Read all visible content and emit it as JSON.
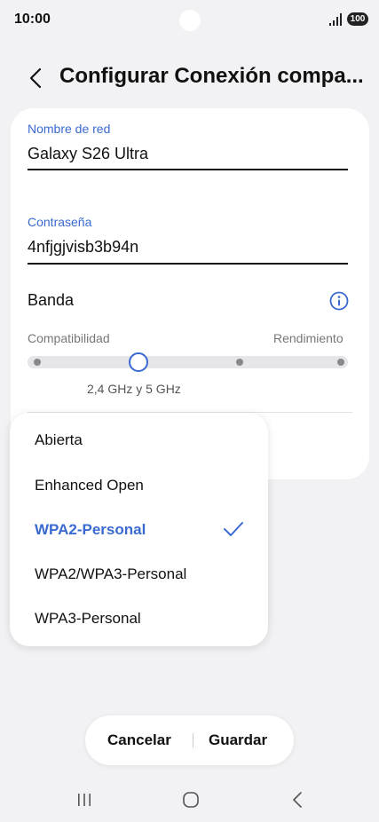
{
  "status_bar": {
    "time": "10:00",
    "battery": "100"
  },
  "header": {
    "title": "Configurar Conexión compa..."
  },
  "network_name": {
    "label": "Nombre de red",
    "value": "Galaxy S26 Ultra"
  },
  "password": {
    "label": "Contraseña",
    "value": "4nfjgjvisb3b94n"
  },
  "band": {
    "label": "Banda",
    "left_label": "Compatibilidad",
    "right_label": "Rendimiento",
    "selected_value": "2,4 GHz y 5 GHz",
    "positions": 4,
    "selected_index": 1
  },
  "security_menu": {
    "items": [
      "Abierta",
      "Enhanced Open",
      "WPA2-Personal",
      "WPA2/WPA3-Personal",
      "WPA3-Personal"
    ],
    "selected": "WPA2-Personal"
  },
  "actions": {
    "cancel": "Cancelar",
    "save": "Guardar"
  },
  "colors": {
    "accent": "#3a6ad0",
    "background": "#f2f2f4",
    "card": "#ffffff"
  },
  "icons": [
    "back-icon",
    "info-icon",
    "check-icon",
    "recents-icon",
    "home-icon",
    "nav-back-icon",
    "signal-icon",
    "battery-icon"
  ]
}
